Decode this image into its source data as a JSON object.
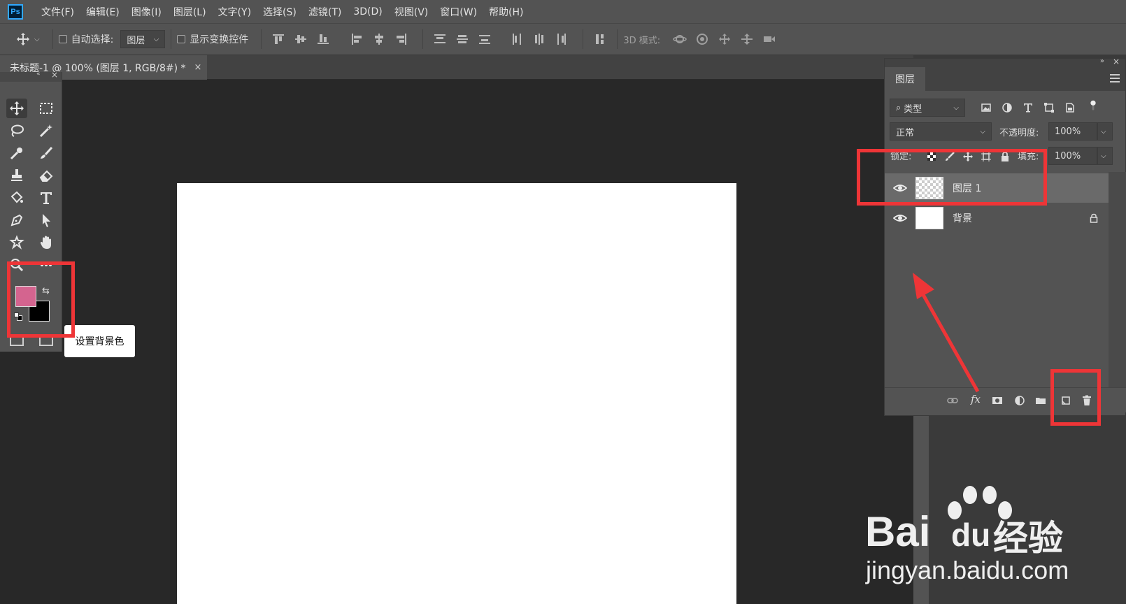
{
  "menu": {
    "app_logo": "Ps",
    "items": [
      "文件(F)",
      "编辑(E)",
      "图像(I)",
      "图层(L)",
      "文字(Y)",
      "选择(S)",
      "滤镜(T)",
      "3D(D)",
      "视图(V)",
      "窗口(W)",
      "帮助(H)"
    ]
  },
  "options": {
    "auto_select_label": "自动选择:",
    "auto_select_value": "图层",
    "show_transform_label": "显示变换控件",
    "mode_3d_label": "3D 模式:"
  },
  "document": {
    "tab_title": "未标题-1 @ 100% (图层 1, RGB/8#) *",
    "close_glyph": "×"
  },
  "toolbox": {
    "tooltip": "设置背景色",
    "foreground_color": "#d4648f",
    "background_color": "#000000"
  },
  "layers_panel": {
    "tab_label": "图层",
    "filter_label": "类型",
    "blend_mode": "正常",
    "opacity_label": "不透明度:",
    "opacity_value": "100%",
    "lock_label": "锁定:",
    "fill_label": "填充:",
    "fill_value": "100%",
    "layers": [
      {
        "name": "图层 1",
        "selected": true,
        "thumb": "transparent"
      },
      {
        "name": "背景",
        "selected": false,
        "thumb": "white",
        "locked": true
      }
    ]
  },
  "watermark": {
    "brand": "Bai",
    "brand_du": "du",
    "brand_cn": "经验",
    "url": "jingyan.baidu.com"
  },
  "annotation_color": "#ee3537"
}
